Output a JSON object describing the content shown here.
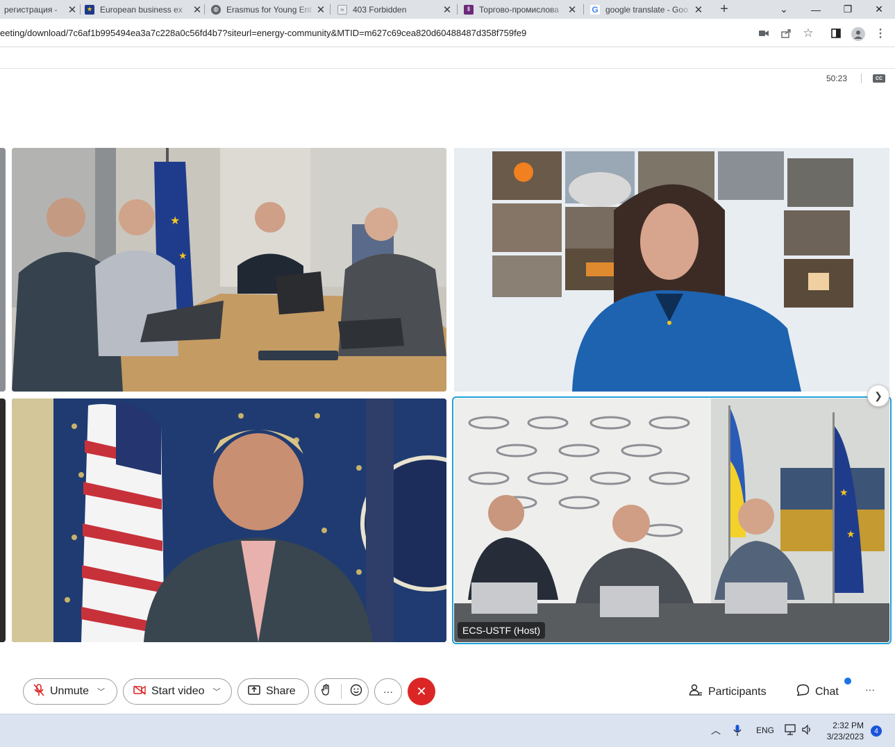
{
  "browser": {
    "tabs": [
      {
        "title": "регистрация -",
        "favicon": "page-icon"
      },
      {
        "title": "European business ex",
        "favicon": "eu-flag-icon"
      },
      {
        "title": "Erasmus for Young Ent",
        "favicon": "globe-icon"
      },
      {
        "title": "403 Forbidden",
        "favicon": "page-icon"
      },
      {
        "title": "Торгово-промислова",
        "favicon": "chamber-icon"
      },
      {
        "title": "google translate - Goo",
        "favicon": "google-icon"
      }
    ],
    "new_tab": "+",
    "url": "eeting/download/7c6af1b995494ea3a7c228a0c56fd4b7?siteurl=energy-community&MTID=m627c69cea820d60488487d358f759fe9"
  },
  "meeting": {
    "timer": "50:23",
    "cc_label": "CC",
    "host_name_tag": "ECS-USTF (Host)",
    "controls": {
      "unmute": "Unmute",
      "start_video": "Start video",
      "share": "Share",
      "more": "···",
      "participants": "Participants",
      "chat": "Chat",
      "more_right": "···"
    }
  },
  "taskbar": {
    "language": "ENG",
    "time": "2:32 PM",
    "date": "3/23/2023",
    "notification_count": "4"
  },
  "colors": {
    "end_call": "#dc2626",
    "active_speaker_border": "#1fa2d6",
    "taskbar": "#dbe3f0"
  }
}
